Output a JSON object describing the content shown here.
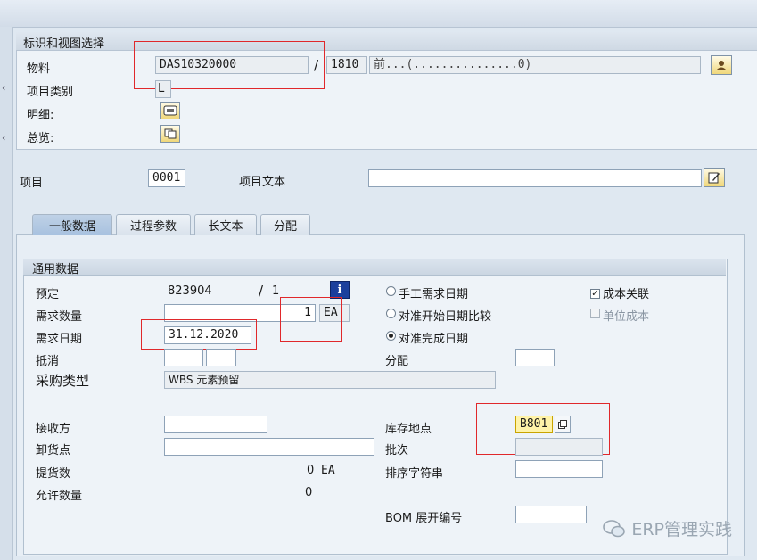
{
  "header": {
    "section_title": "标识和视图选择",
    "material_label": "物料",
    "material_value": "DAS10320000",
    "slash": "/",
    "plant_value": "1810",
    "material_desc": "前...(...............0)",
    "item_category_label": "项目类别",
    "item_category_value": "L",
    "detail_label": "明细:",
    "overview_label": "总览:"
  },
  "item": {
    "item_label": "项目",
    "item_value": "0001",
    "item_text_label": "项目文本",
    "item_text_value": ""
  },
  "tabs": [
    {
      "label": "一般数据",
      "active": true
    },
    {
      "label": "过程参数",
      "active": false
    },
    {
      "label": "长文本",
      "active": false
    },
    {
      "label": "分配",
      "active": false
    }
  ],
  "general": {
    "group_title": "通用数据",
    "reservation_label": "预定",
    "reservation_value": "823904",
    "reservation_slash": "/",
    "reservation_item": "1",
    "req_qty_label": "需求数量",
    "req_qty_value": "1",
    "req_qty_unit": "EA",
    "req_date_label": "需求日期",
    "req_date_value": "31.12.2020",
    "offset_label": "抵消",
    "purch_type_label": "采购类型",
    "purch_type_value": "WBS 元素预留",
    "recipient_label": "接收方",
    "unloading_label": "卸货点",
    "withdrawn_label": "提货数",
    "withdrawn_value": "0",
    "withdrawn_unit": "EA",
    "allowed_label": "允许数量",
    "allowed_value": "0",
    "radio_manual": "手工需求日期",
    "radio_start": "对准开始日期比较",
    "radio_finish": "对准完成日期",
    "distribution_label": "分配",
    "storage_label": "库存地点",
    "storage_value": "B801",
    "batch_label": "批次",
    "sort_label": "排序字符串",
    "bom_label": "BOM 展开编号",
    "cost_relevant_label": "成本关联",
    "unit_cost_label": "单位成本"
  },
  "watermark": "ERP管理实践",
  "colors": {
    "highlight_red": "#e0282b",
    "field_yellow": "#fff3a8"
  }
}
